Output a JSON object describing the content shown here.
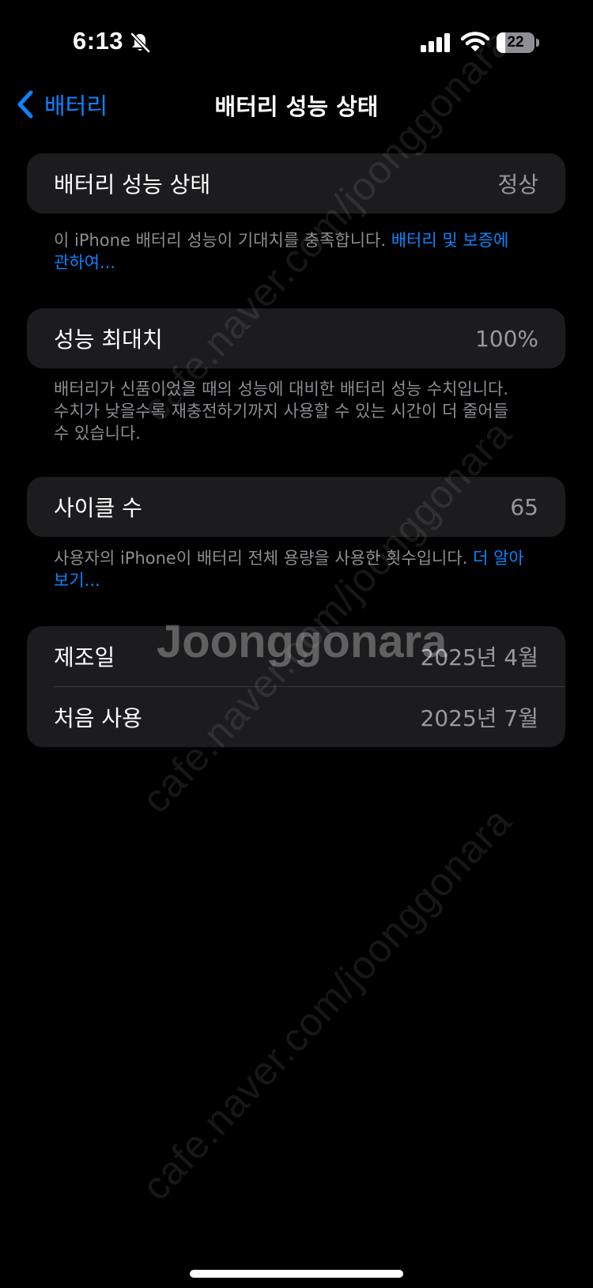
{
  "status_bar": {
    "time": "6:13",
    "battery_level": "22",
    "battery_fraction": 0.22
  },
  "nav": {
    "back_label": "배터리",
    "title": "배터리 성능 상태"
  },
  "health": {
    "label": "배터리 성능 상태",
    "value": "정상",
    "footer_text": "이 iPhone 배터리 성능이 기대치를 충족합니다. ",
    "footer_link": "배터리 및 보증에 관하여..."
  },
  "max_capacity": {
    "label": "성능 최대치",
    "value": "100%",
    "footer_text": "배터리가 신품이었을 때의 성능에 대비한 배터리 성능 수치입니다. 수치가 낮을수록 재충전하기까지 사용할 수 있는 시간이 더 줄어들 수 있습니다."
  },
  "cycle_count": {
    "label": "사이클 수",
    "value": "65",
    "footer_text": "사용자의 iPhone이 배터리 전체 용량을 사용한 횟수입니다. ",
    "footer_link": "더 알아보기..."
  },
  "dates": {
    "manufacture_label": "제조일",
    "manufacture_value": "2025년 4월",
    "first_use_label": "처음 사용",
    "first_use_value": "2025년 7월"
  },
  "watermark": {
    "text": "cafe.naver.com/joonggonara",
    "logo": "Joonggonara"
  },
  "icons": {
    "bell": "bell-slash-icon",
    "signal": "cellular-signal-icon",
    "wifi": "wifi-icon",
    "battery": "battery-icon",
    "back": "chevron-left-icon"
  },
  "colors": {
    "background": "#000000",
    "group_background": "#1c1c1e",
    "accent": "#0a84ff",
    "secondary_text": "#8d8d93"
  }
}
